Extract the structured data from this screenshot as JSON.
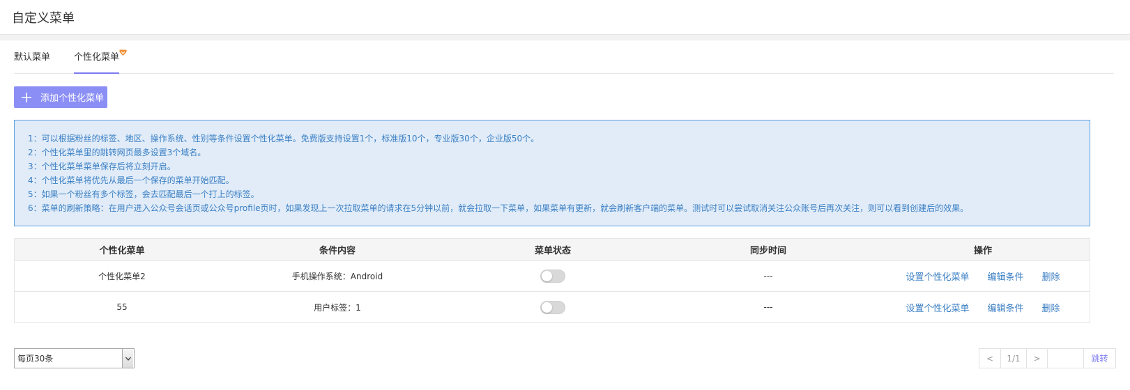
{
  "page": {
    "title": "自定义菜单"
  },
  "tabs": [
    {
      "label": "默认菜单"
    },
    {
      "label": "个性化菜单"
    }
  ],
  "add_button": {
    "label": "添加个性化菜单"
  },
  "notice": {
    "lines": [
      "1：可以根据粉丝的标签、地区、操作系统、性别等条件设置个性化菜单。免费版支持设置1个，标准版10个，专业版30个，企业版50个。",
      "2：个性化菜单里的跳转网页最多设置3个域名。",
      "3：个性化菜单菜单保存后将立刻开启。",
      "4：个性化菜单将优先从最后一个保存的菜单开始匹配。",
      "5：如果一个粉丝有多个标签，会去匹配最后一个打上的标签。",
      "6：菜单的刷新策略：在用户进入公众号会话页或公众号profile页时，如果发现上一次拉取菜单的请求在5分钟以前，就会拉取一下菜单，如果菜单有更新，就会刷新客户端的菜单。测试时可以尝试取消关注公众账号后再次关注，则可以看到创建后的效果。"
    ]
  },
  "table": {
    "headers": [
      "个性化菜单",
      "条件内容",
      "菜单状态",
      "同步时间",
      "操作"
    ],
    "rows": [
      {
        "name": "个性化菜单2",
        "condition": "手机操作系统：Android",
        "enabled": false,
        "sync_time": "---"
      },
      {
        "name": "55",
        "condition": "用户标签：1",
        "enabled": false,
        "sync_time": "---"
      }
    ],
    "actions": {
      "set": "设置个性化菜单",
      "edit": "编辑条件",
      "delete": "删除"
    }
  },
  "pagination": {
    "page_size_label": "每页30条",
    "prev": "<",
    "page_indicator": "1/1",
    "next": ">",
    "jump_input": "",
    "jump_label": "跳转"
  },
  "colors": {
    "accent": "#7c7bf0",
    "button": "#8b8ff5",
    "link": "#3b7fc4",
    "notice_bg": "#e1ecf8",
    "notice_border": "#5aa0e4"
  }
}
